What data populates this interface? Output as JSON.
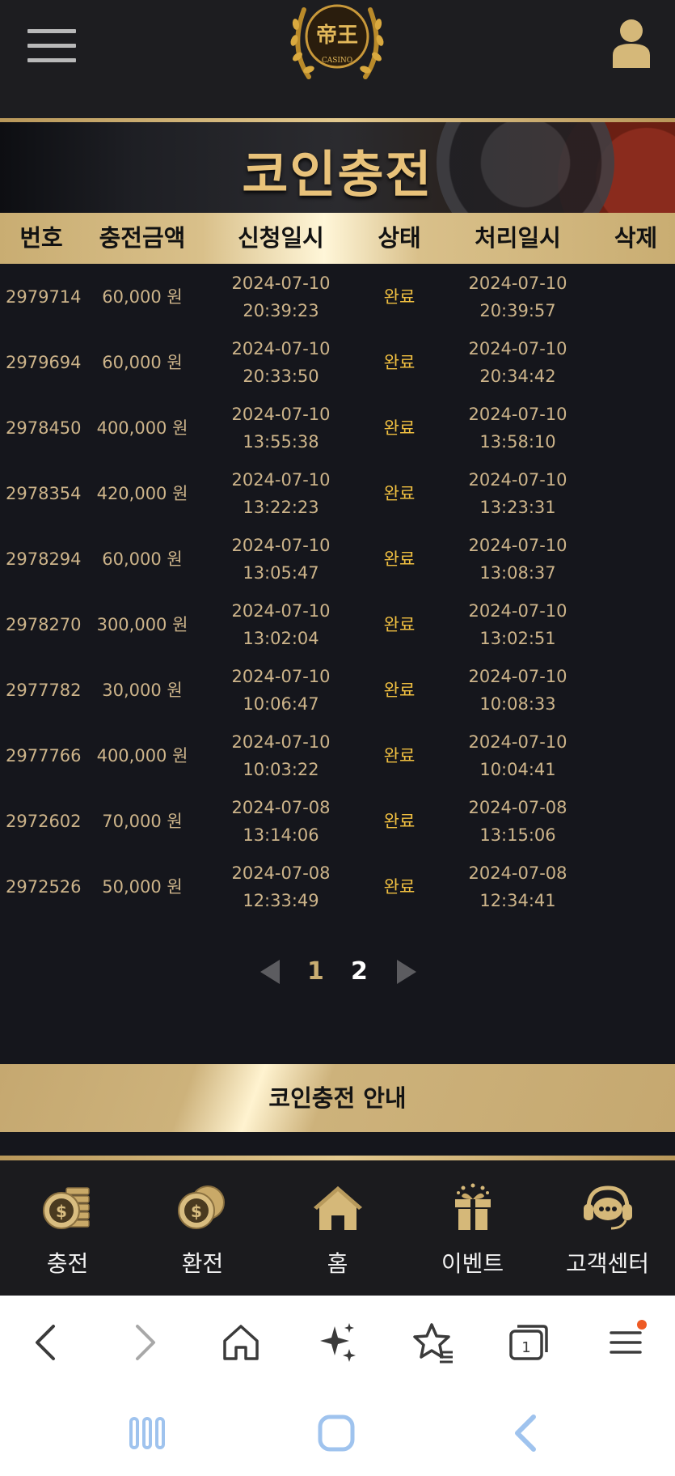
{
  "header": {
    "logo_text": "CASINO"
  },
  "banner": {
    "title": "코인충전"
  },
  "table": {
    "columns": [
      "번호",
      "충전금액",
      "신청일시",
      "상태",
      "처리일시",
      "삭제"
    ],
    "rows": [
      {
        "id": "2979714",
        "amount": "60,000 원",
        "req_date": "2024-07-10",
        "req_time": "20:39:23",
        "status": "완료",
        "proc_date": "2024-07-10",
        "proc_time": "20:39:57"
      },
      {
        "id": "2979694",
        "amount": "60,000 원",
        "req_date": "2024-07-10",
        "req_time": "20:33:50",
        "status": "완료",
        "proc_date": "2024-07-10",
        "proc_time": "20:34:42"
      },
      {
        "id": "2978450",
        "amount": "400,000 원",
        "req_date": "2024-07-10",
        "req_time": "13:55:38",
        "status": "완료",
        "proc_date": "2024-07-10",
        "proc_time": "13:58:10"
      },
      {
        "id": "2978354",
        "amount": "420,000 원",
        "req_date": "2024-07-10",
        "req_time": "13:22:23",
        "status": "완료",
        "proc_date": "2024-07-10",
        "proc_time": "13:23:31"
      },
      {
        "id": "2978294",
        "amount": "60,000 원",
        "req_date": "2024-07-10",
        "req_time": "13:05:47",
        "status": "완료",
        "proc_date": "2024-07-10",
        "proc_time": "13:08:37"
      },
      {
        "id": "2978270",
        "amount": "300,000 원",
        "req_date": "2024-07-10",
        "req_time": "13:02:04",
        "status": "완료",
        "proc_date": "2024-07-10",
        "proc_time": "13:02:51"
      },
      {
        "id": "2977782",
        "amount": "30,000 원",
        "req_date": "2024-07-10",
        "req_time": "10:06:47",
        "status": "완료",
        "proc_date": "2024-07-10",
        "proc_time": "10:08:33"
      },
      {
        "id": "2977766",
        "amount": "400,000 원",
        "req_date": "2024-07-10",
        "req_time": "10:03:22",
        "status": "완료",
        "proc_date": "2024-07-10",
        "proc_time": "10:04:41"
      },
      {
        "id": "2972602",
        "amount": "70,000 원",
        "req_date": "2024-07-08",
        "req_time": "13:14:06",
        "status": "완료",
        "proc_date": "2024-07-08",
        "proc_time": "13:15:06"
      },
      {
        "id": "2972526",
        "amount": "50,000 원",
        "req_date": "2024-07-08",
        "req_time": "12:33:49",
        "status": "완료",
        "proc_date": "2024-07-08",
        "proc_time": "12:34:41"
      }
    ]
  },
  "pagination": {
    "pages": [
      "1",
      "2"
    ],
    "current": "1"
  },
  "info_bar": {
    "label": "코인충전 안내"
  },
  "bottom_nav": [
    {
      "label": "충전",
      "icon": "coin-stack-icon"
    },
    {
      "label": "환전",
      "icon": "coins-icon"
    },
    {
      "label": "홈",
      "icon": "home-icon"
    },
    {
      "label": "이벤트",
      "icon": "gift-icon"
    },
    {
      "label": "고객센터",
      "icon": "headset-icon"
    }
  ],
  "colors": {
    "gold": "#c9ad72",
    "status": "#f1c041",
    "background": "#15161c"
  }
}
